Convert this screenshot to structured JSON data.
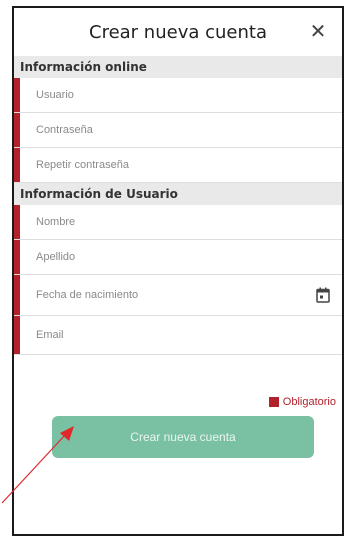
{
  "header": {
    "title": "Crear nueva cuenta",
    "close_glyph": "✕"
  },
  "sections": {
    "online": "Información online",
    "user": "Información de Usuario"
  },
  "fields": {
    "usuario": "Usuario",
    "contrasena": "Contraseña",
    "repetir": "Repetir contraseña",
    "nombre": "Nombre",
    "apellido": "Apellido",
    "fecha": "Fecha de nacimiento",
    "email": "Email"
  },
  "legend": {
    "label": "Obligatorio"
  },
  "button": {
    "label": "Crear nueva cuenta"
  },
  "colors": {
    "required": "#b3212b",
    "button": "#79c1a2",
    "section_bg": "#e9e9e9",
    "arrow": "#e0282b"
  },
  "icons": {
    "close": "close-icon",
    "calendar": "calendar-icon",
    "annotation": "red-arrow"
  }
}
